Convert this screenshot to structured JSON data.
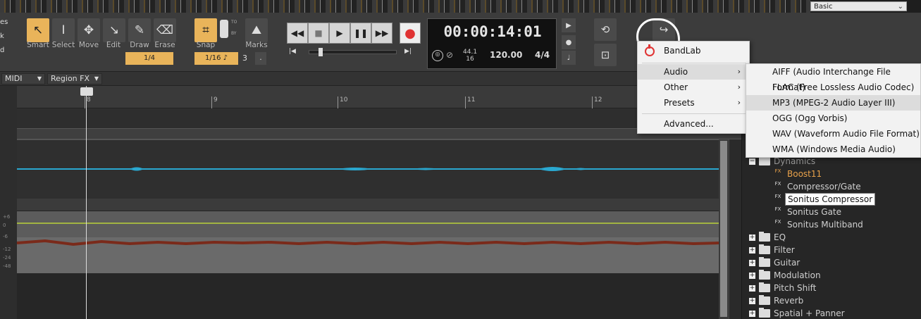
{
  "workspace": {
    "label": "Basic"
  },
  "side_labels": [
    "es",
    "k",
    "d"
  ],
  "tools": [
    {
      "name": "smart",
      "label": "Smart",
      "glyph": "↖"
    },
    {
      "name": "select",
      "label": "Select",
      "glyph": "I"
    },
    {
      "name": "move",
      "label": "Move",
      "glyph": "✥"
    },
    {
      "name": "edit",
      "label": "Edit",
      "glyph": "↘"
    },
    {
      "name": "draw",
      "label": "Draw",
      "glyph": "✎"
    },
    {
      "name": "erase",
      "label": "Erase",
      "glyph": "⌫"
    }
  ],
  "tool_snap_value": "1/4",
  "snap": {
    "label": "Snap",
    "value": "1/16",
    "to": "TO",
    "by": "BY",
    "marks_label": "Marks",
    "count": "3",
    "dot": "."
  },
  "transport": {
    "rewind_glyph": "◀◀",
    "stop_glyph": "■",
    "play_glyph": "▶",
    "pause_glyph": "❚❚",
    "ff_glyph": "▶▶",
    "goto_start_glyph": "|◀",
    "goto_end_glyph": "▶|",
    "record_glyph": "●"
  },
  "time": {
    "display": "00:00:14:01",
    "rate_top": "44.1",
    "rate_bottom": "16",
    "tempo": "120.00",
    "meter": "4/4"
  },
  "track_header": {
    "midi": "MIDI",
    "region_fx": "Region FX"
  },
  "ruler": {
    "bars": [
      "8",
      "9",
      "10",
      "11",
      "12"
    ]
  },
  "meter_scale": [
    "+6",
    "0",
    "-6",
    "-12",
    "-24",
    "-48"
  ],
  "main_menu": {
    "items": [
      {
        "label": "BandLab",
        "has_sub": false
      },
      {
        "label": "Audio",
        "has_sub": true,
        "arrow": "›"
      },
      {
        "label": "Other",
        "has_sub": true,
        "arrow": "›"
      },
      {
        "label": "Presets",
        "has_sub": true,
        "arrow": "›"
      },
      {
        "label": "Advanced...",
        "has_sub": false
      }
    ]
  },
  "audio_submenu": {
    "items": [
      "AIFF (Audio Interchange File Format)",
      "FLAC (Free Lossless Audio Codec)",
      "MP3 (MPEG-2 Audio Layer III)",
      "OGG (Ogg Vorbis)",
      "WAV (Waveform Audio File Format)",
      "WMA (Windows Media Audio)"
    ]
  },
  "browser": {
    "dynamics": "Dynamics",
    "fx_items": [
      "Boost11",
      "Compressor/Gate",
      "Sonitus Compressor",
      "Sonitus Gate",
      "Sonitus Multiband"
    ],
    "folders": [
      "EQ",
      "Filter",
      "Guitar",
      "Modulation",
      "Pitch Shift",
      "Reverb",
      "Spatial + Panner"
    ]
  },
  "colors": {
    "accent": "#e9b45a",
    "wave_blue": "#2aa8d0",
    "wave_red": "#7a2a1a",
    "record": "#e03333"
  }
}
